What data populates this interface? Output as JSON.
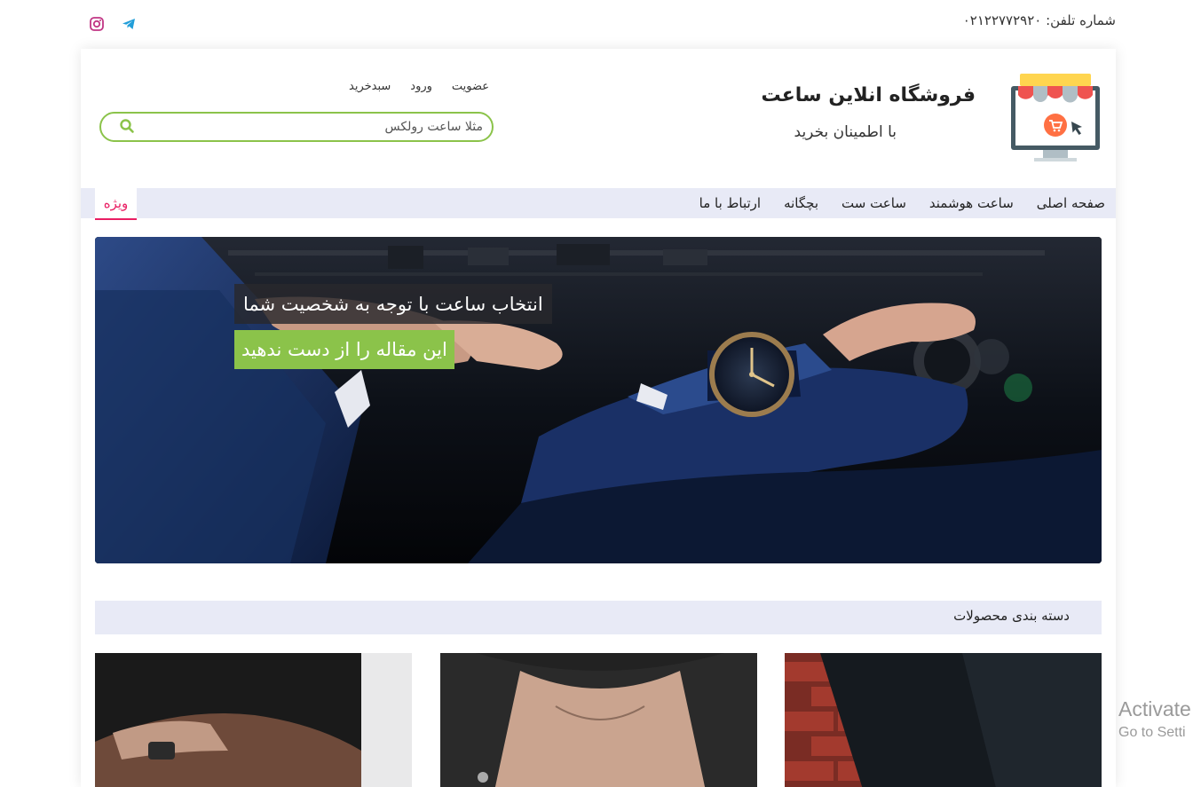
{
  "topbar": {
    "phone_label": "شماره تلفن: ۰۲۱۲۲۷۷۲۹۲۰"
  },
  "social": [
    {
      "icon": "instagram-icon",
      "color": "#c13584"
    },
    {
      "icon": "telegram-icon",
      "color": "#229ed9"
    }
  ],
  "header": {
    "title": "فروشگاه انلاین ساعت",
    "subtitle": "با اطمینان بخرید",
    "logo_icon": "store-cart-icon"
  },
  "userlinks": {
    "register": "عضویت",
    "login": "ورود",
    "cart": "سبدخرید"
  },
  "search": {
    "placeholder": "مثلا ساعت رولکس",
    "icon": "search-icon",
    "accent": "#8bc34a"
  },
  "nav": {
    "items": [
      {
        "label": "صفحه اصلی"
      },
      {
        "label": "ساعت هوشمند"
      },
      {
        "label": "ساعت ست"
      },
      {
        "label": "بچگانه"
      },
      {
        "label": "ارتباط با ما"
      }
    ],
    "special_label": "ویژه",
    "special_color": "#e91e63",
    "bar_color": "#e8eaf6"
  },
  "hero": {
    "caption": "انتخاب ساعت با توجه به شخصیت شما",
    "cta": "این مقاله را از دست ندهید"
  },
  "categories": {
    "title": "دسته بندی محصولات"
  },
  "watermark": {
    "line1": "Activate",
    "line2": "Go to Setti"
  }
}
